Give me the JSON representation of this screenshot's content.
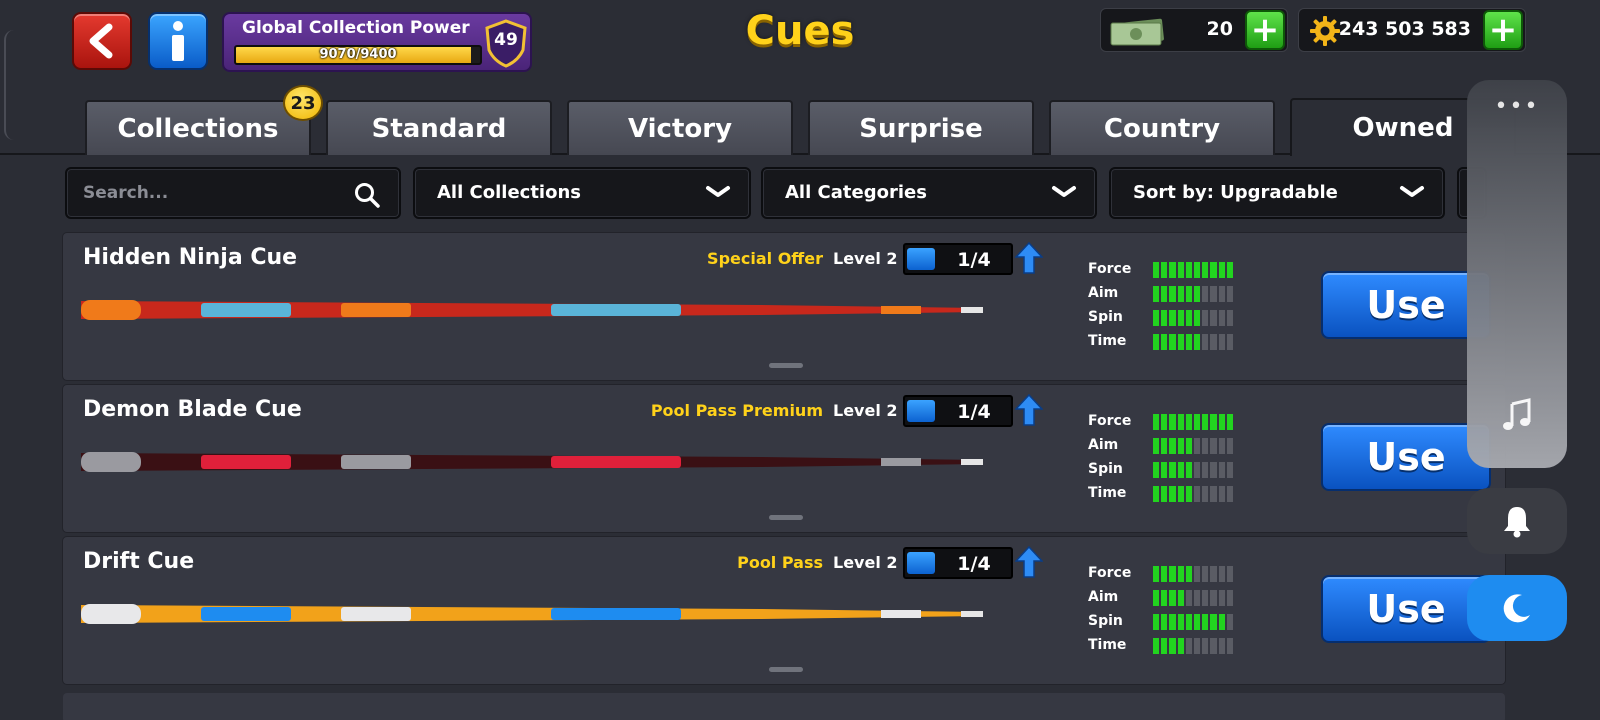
{
  "header": {
    "title": "Cues",
    "back_icon": "back-arrow-icon",
    "info_icon": "info-icon",
    "collection_power": {
      "label": "Global Collection Power",
      "progress_text": "9070/9400",
      "progress_fraction": 0.965,
      "level": "49"
    },
    "currencies": [
      {
        "name": "cash",
        "icon": "cash-icon",
        "value": "20"
      },
      {
        "name": "coins",
        "icon": "coin-gear-icon",
        "value": "243 503 583"
      }
    ],
    "plus_label": "+"
  },
  "tabs": [
    {
      "label": "Collections",
      "badge": "23",
      "active": false
    },
    {
      "label": "Standard",
      "active": false
    },
    {
      "label": "Victory",
      "active": false
    },
    {
      "label": "Surprise",
      "active": false
    },
    {
      "label": "Country",
      "active": false
    },
    {
      "label": "Owned",
      "active": true
    }
  ],
  "filters": {
    "search_placeholder": "Search...",
    "collections": "All Collections",
    "categories": "All Categories",
    "sort": "Sort by: Upgradable"
  },
  "stat_labels": [
    "Force",
    "Aim",
    "Spin",
    "Time"
  ],
  "cues": [
    {
      "name": "Hidden Ninja Cue",
      "source": "Special Offer",
      "level_label": "Level 2",
      "progress": "1/4",
      "stats": {
        "force": 10,
        "aim": 6,
        "spin": 6,
        "time": 6
      },
      "use_label": "Use",
      "colors": {
        "main": "#c8281c",
        "accent": "#5ab4d8",
        "trim": "#f07a1a"
      }
    },
    {
      "name": "Demon Blade Cue",
      "source": "Pool Pass Premium",
      "level_label": "Level 2",
      "progress": "1/4",
      "stats": {
        "force": 10,
        "aim": 5,
        "spin": 5,
        "time": 5
      },
      "use_label": "Use",
      "colors": {
        "main": "#3a1014",
        "accent": "#e0203a",
        "trim": "#9a9aa0"
      }
    },
    {
      "name": "Drift Cue",
      "source": "Pool Pass",
      "level_label": "Level 2",
      "progress": "1/4",
      "stats": {
        "force": 5,
        "aim": 4,
        "spin": 9,
        "time": 4
      },
      "use_label": "Use",
      "colors": {
        "main": "#f2a21a",
        "accent": "#1e8cf0",
        "trim": "#e8e8ea"
      }
    }
  ],
  "overlay": {
    "menu_icon": "more-dots-icon",
    "music_icon": "music-note-icon",
    "bell_icon": "bell-icon",
    "moon_icon": "moon-icon"
  }
}
